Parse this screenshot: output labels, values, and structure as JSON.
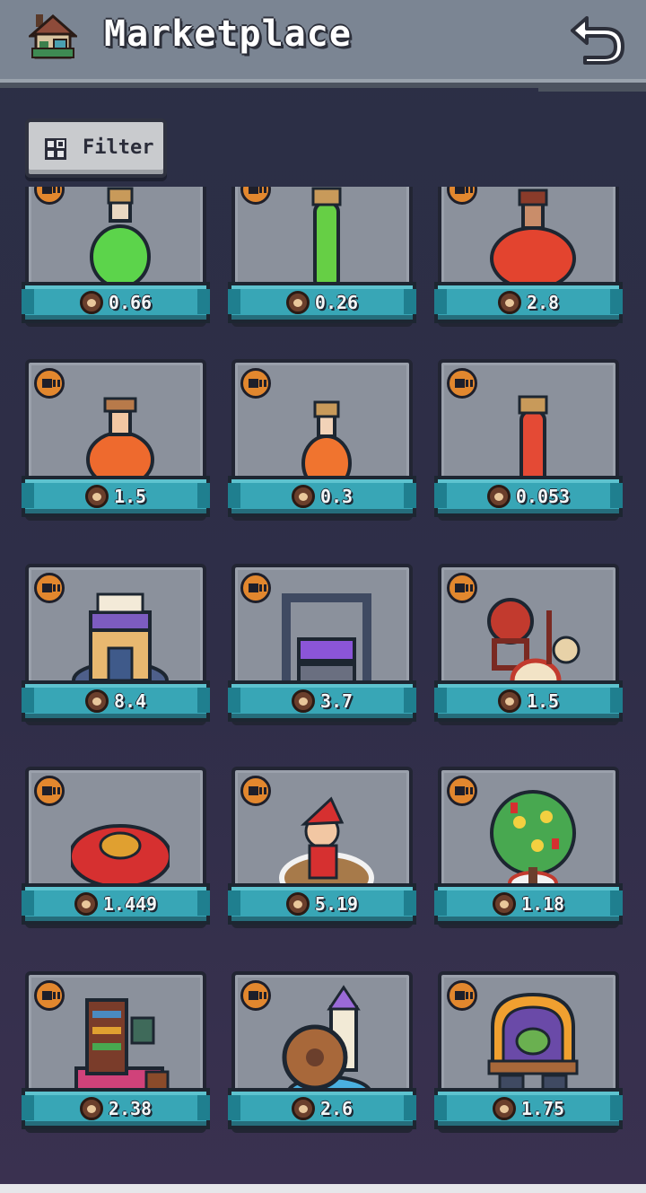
{
  "header": {
    "title": "Marketplace",
    "shop_icon": "house-shop-icon",
    "back_icon": "back-arrow-icon"
  },
  "filter": {
    "label": "Filter",
    "icon": "grid-filter-icon"
  },
  "colors": {
    "header_bg": "#7b8593",
    "page_bg": "#2b2f45",
    "card_bg": "#8b919c",
    "ribbon": "#38a6b6",
    "badge": "#e2872e"
  },
  "items": [
    {
      "name": "green-round-potion",
      "price": "0.66",
      "icon": "potion-green-round-icon"
    },
    {
      "name": "green-vial-potion",
      "price": "0.26",
      "icon": "potion-green-vial-icon"
    },
    {
      "name": "red-large-flask-potion",
      "price": "2.8",
      "icon": "potion-red-flask-icon"
    },
    {
      "name": "orange-round-flask-potion",
      "price": "1.5",
      "icon": "potion-orange-flask-icon"
    },
    {
      "name": "orange-small-potion",
      "price": "0.3",
      "icon": "potion-orange-small-icon"
    },
    {
      "name": "red-vial-potion",
      "price": "0.053",
      "icon": "potion-red-vial-icon"
    },
    {
      "name": "magic-library-building",
      "price": "8.4",
      "icon": "library-building-icon"
    },
    {
      "name": "conveyor-workshop-building",
      "price": "3.7",
      "icon": "workshop-building-icon"
    },
    {
      "name": "lion-dance-drum-stage",
      "price": "1.5",
      "icon": "lion-dance-icon"
    },
    {
      "name": "hotpot-banquet-table",
      "price": "1.449",
      "icon": "banquet-table-icon"
    },
    {
      "name": "christmas-character-stage",
      "price": "5.19",
      "icon": "christmas-stage-icon"
    },
    {
      "name": "fortune-money-tree",
      "price": "1.18",
      "icon": "money-tree-icon"
    },
    {
      "name": "study-room-bookshelf",
      "price": "2.38",
      "icon": "study-room-icon"
    },
    {
      "name": "watermill-tower",
      "price": "2.6",
      "icon": "watermill-icon"
    },
    {
      "name": "arcade-cauldron-stage",
      "price": "1.75",
      "icon": "arcade-stage-icon"
    }
  ]
}
